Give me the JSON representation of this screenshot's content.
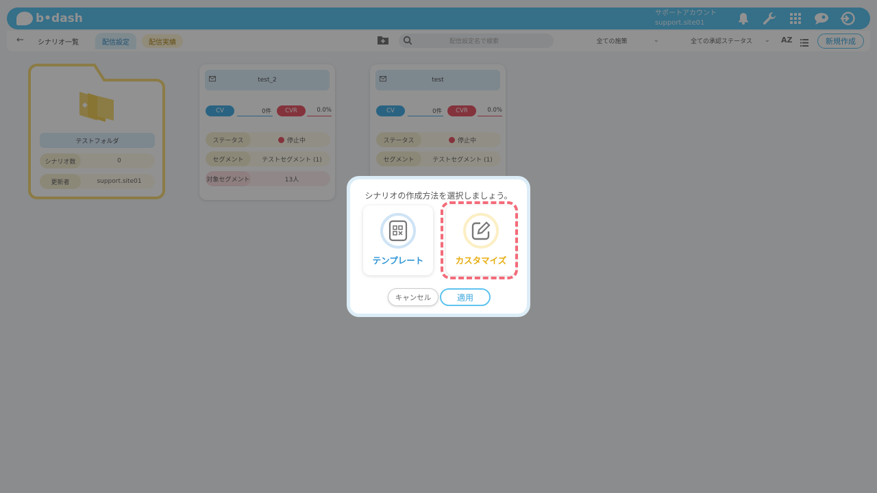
{
  "header": {
    "logo_text": "b•dash",
    "account_name": "サポートアカウント",
    "account_id": "support.site01",
    "icons": [
      "bell-icon",
      "wrench-icon",
      "apps-grid-icon",
      "chat-bubble-icon",
      "logout-icon"
    ]
  },
  "toolbar": {
    "breadcrumb": "シナリオ一覧",
    "tabs": [
      {
        "label": "配信設定"
      },
      {
        "label": "配信実績"
      }
    ],
    "search_placeholder": "配信設定名で検索",
    "filter_scenarios": "全ての施策",
    "filter_status": "全ての承認ステータス",
    "sort_label": "AZ",
    "new_button": "新規作成"
  },
  "folder": {
    "name": "テストフォルダ",
    "rows": [
      {
        "key": "シナリオ数",
        "value": "0"
      },
      {
        "key": "更新者",
        "value": "support.site01"
      }
    ]
  },
  "cards": [
    {
      "title": "test_2",
      "cv_label": "CV",
      "cv_value": "0件",
      "cvr_label": "CVR",
      "cvr_value": "0.0%",
      "status_key": "ステータス",
      "status_value": "停止中",
      "segment_key": "セグメント",
      "segment_value": "テストセグメント (1)",
      "target_key": "対象セグメント",
      "target_value": "13人"
    },
    {
      "title": "test",
      "cv_label": "CV",
      "cv_value": "0件",
      "cvr_label": "CVR",
      "cvr_value": "0.0%",
      "status_key": "ステータス",
      "status_value": "停止中",
      "segment_key": "セグメント",
      "segment_value": "テストセグメント (1)"
    }
  ],
  "modal": {
    "title": "シナリオの作成方法を選択しましょう。",
    "options": [
      {
        "label": "テンプレート",
        "icon": "template-grid-icon",
        "color": "#2f95d6"
      },
      {
        "label": "カスタマイズ",
        "icon": "edit-pencil-icon",
        "color": "#e8ad10"
      }
    ],
    "cancel_label": "キャンセル",
    "apply_label": "適用",
    "highlight_color": "#f36b7a"
  },
  "colors": {
    "brand": "#5ec3ef",
    "cv": "#4aaee4",
    "cvr": "#e85b6a"
  }
}
